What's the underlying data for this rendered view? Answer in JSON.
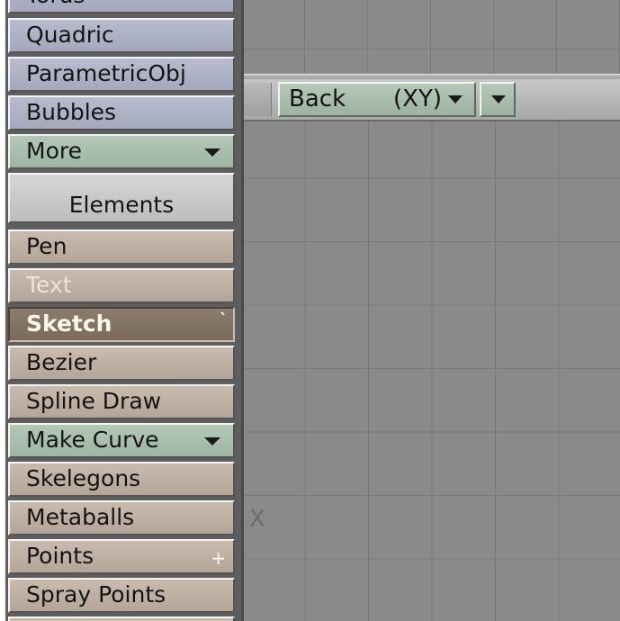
{
  "tools": {
    "cut_top": "Torus",
    "quadric": "Quadric",
    "parametric": "ParametricObj",
    "bubbles": "Bubbles",
    "more": "More",
    "elements_header": "Elements",
    "pen": "Pen",
    "text": "Text",
    "sketch": "Sketch",
    "bezier": "Bezier",
    "spline_draw": "Spline Draw",
    "make_curve": "Make Curve",
    "skelegons": "Skelegons",
    "metaballs": "Metaballs",
    "points": "Points",
    "spray_points": "Spray Points"
  },
  "viewport": {
    "view_name": "Back",
    "view_axis": "(XY)",
    "axis_marker": "X"
  },
  "colors": {
    "tool_blue": "#a8adc1",
    "tool_green": "#a5b9a8",
    "tool_tan": "#bbad9f",
    "tool_active": "#807061",
    "viewport_bg": "#8a8a8a",
    "grid_line": "#787878"
  },
  "icons": {
    "dropdown": "chevron-down-icon",
    "points_extra": "plus-icon"
  }
}
